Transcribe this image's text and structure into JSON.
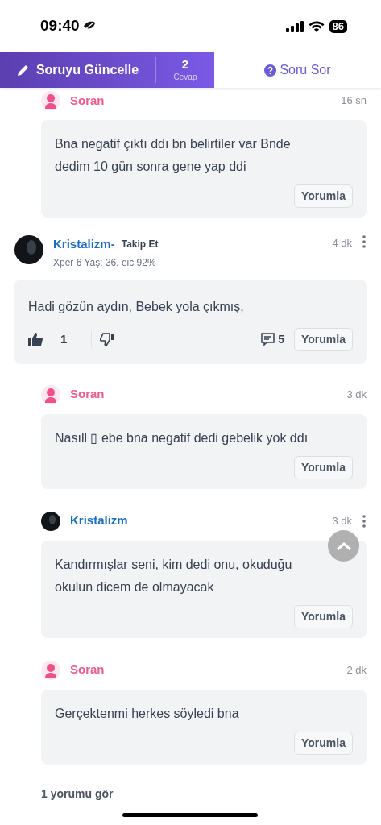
{
  "status_bar": {
    "time": "09:40",
    "battery": "86"
  },
  "tabs": [
    {
      "kind": "update",
      "label": "Soruyu Güncelle",
      "count": "2",
      "count_label": "Cevap",
      "selected": true
    },
    {
      "kind": "ask",
      "label": "Soru Sor",
      "selected": false
    }
  ],
  "thread_top": {
    "kind": "asker",
    "author": "Soran",
    "time": "16 sn",
    "text": "Bna negatif çıktı ddı bn belirtiler var Bnde dedim 10 gün sonra gene yap ddi",
    "button": "Yorumla"
  },
  "comment": {
    "author": "Kristalizm-",
    "follow": "Takip Et",
    "meta": "Xper 6 Yaş: 36, eic 92%",
    "time": "4 dk",
    "text": "Hadi gözün aydın, Bebek yola çıkmış,",
    "likes": "1",
    "replies_count": "5",
    "button": "Yorumla"
  },
  "replies": [
    {
      "kind": "asker",
      "author": "Soran",
      "time": "3 dk",
      "text": "Nasıll ▯ ebe bna negatif dedi gebelik yok ddı",
      "button": "Yorumla"
    },
    {
      "kind": "user",
      "author": "Kristalizm",
      "time": "3 dk",
      "text": "Kandırmışlar seni, kim dedi onu, okuduğu okulun dicem de olmayacak",
      "button": "Yorumla"
    },
    {
      "kind": "asker",
      "author": "Soran",
      "time": "2 dk",
      "text": "Gerçektenmi herkes söyledi bna",
      "button": "Yorumla"
    }
  ],
  "more_link": "1 yorumu gör"
}
